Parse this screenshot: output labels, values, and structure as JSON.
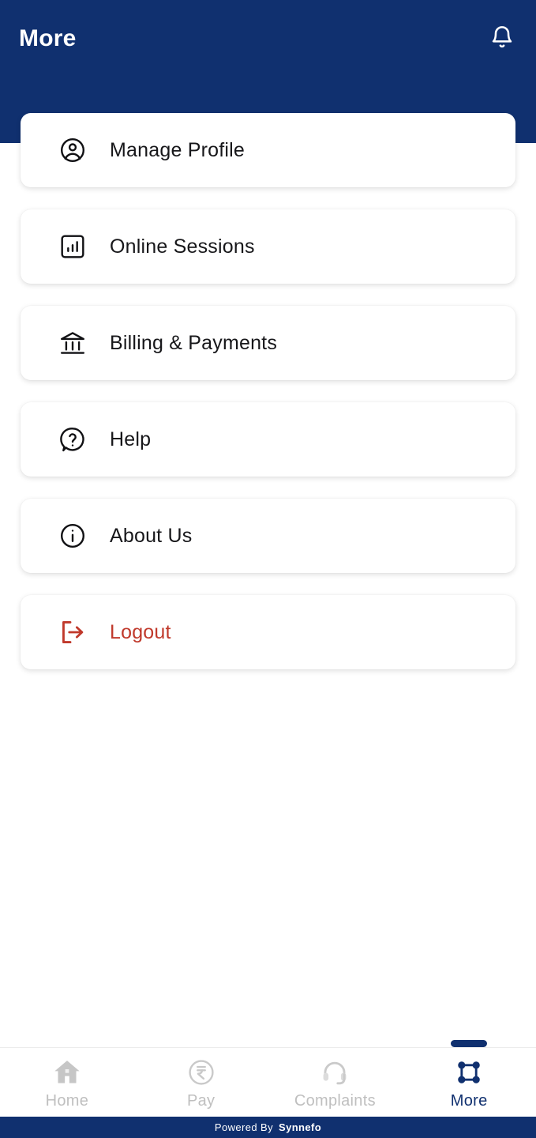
{
  "header": {
    "title": "More",
    "notification_icon": "bell-icon",
    "background_color": "#10306F",
    "title_color": "#FFFFFF"
  },
  "menu": {
    "items": [
      {
        "label": "Manage Profile",
        "icon": "user-circle-icon",
        "color": "#17171A"
      },
      {
        "label": "Online Sessions",
        "icon": "bar-chart-box-icon",
        "color": "#17171A"
      },
      {
        "label": "Billing & Payments",
        "icon": "bank-icon",
        "color": "#17171A"
      },
      {
        "label": "Help",
        "icon": "question-bubble-icon",
        "color": "#17171A"
      },
      {
        "label": "About Us",
        "icon": "info-circle-icon",
        "color": "#17171A"
      },
      {
        "label": "Logout",
        "icon": "logout-icon",
        "color": "#C0392B"
      }
    ]
  },
  "bottom_nav": {
    "active_index": 3,
    "active_color": "#10306F",
    "inactive_color": "#BFBFBF",
    "items": [
      {
        "label": "Home",
        "icon": "home-icon"
      },
      {
        "label": "Pay",
        "icon": "rupee-circle-icon"
      },
      {
        "label": "Complaints",
        "icon": "headset-icon"
      },
      {
        "label": "More",
        "icon": "grid-dots-icon"
      }
    ]
  },
  "footer": {
    "powered_by": "Powered By",
    "brand": "Synnefo",
    "background_color": "#10306F"
  }
}
